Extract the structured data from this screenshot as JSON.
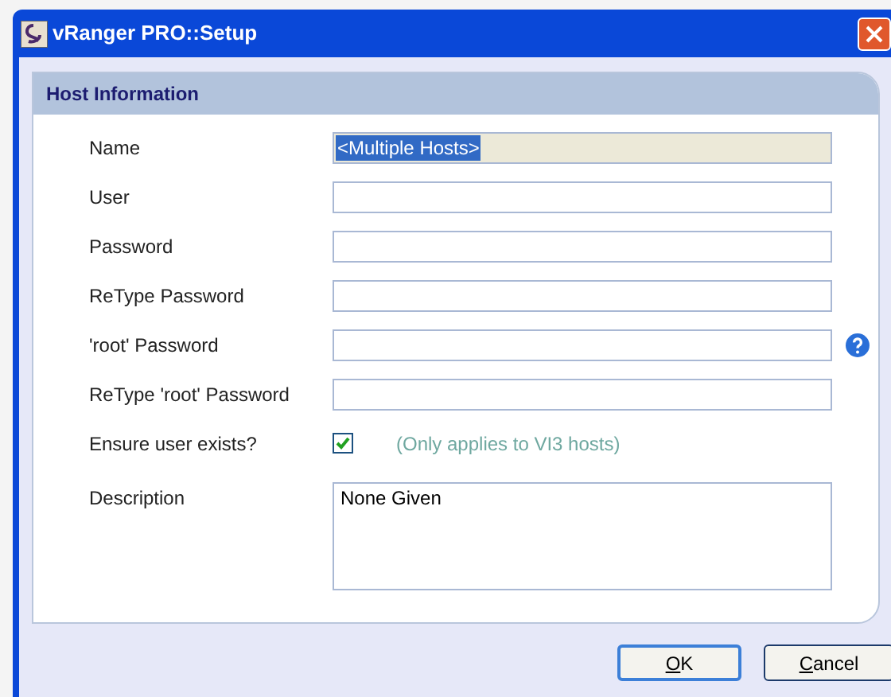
{
  "window": {
    "title": "vRanger PRO::Setup"
  },
  "panel": {
    "title": "Host Information"
  },
  "fields": [
    {
      "kind": "text",
      "label": "Name",
      "value": "<Multiple Hosts>",
      "selected": true,
      "readonly": true
    },
    {
      "kind": "text",
      "label": "User"
    },
    {
      "kind": "text",
      "label": "Password"
    },
    {
      "kind": "text",
      "label": "ReType Password"
    },
    {
      "kind": "help",
      "label": "'root' Password"
    },
    {
      "kind": "text",
      "label": "ReType 'root' Password"
    },
    {
      "kind": "checkbox",
      "label": "Ensure user exists?",
      "checked": true,
      "note": "(Only applies to VI3 hosts)"
    },
    {
      "kind": "textarea",
      "label": "Description",
      "value": "None Given"
    }
  ],
  "buttons": [
    {
      "label": "OK",
      "default": true
    },
    {
      "label": "Cancel",
      "default": false
    }
  ]
}
